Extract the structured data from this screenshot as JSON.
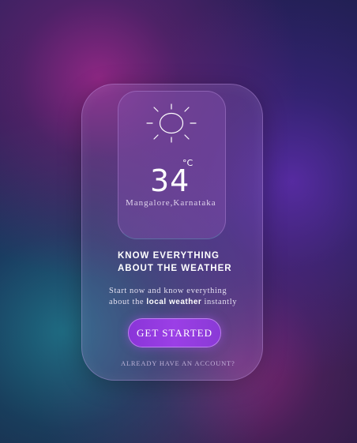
{
  "weather": {
    "temperature": "34",
    "unit": "°C",
    "location": "Mangalore,Karnataka",
    "icon": "sun-icon"
  },
  "headline": {
    "line1": "KNOW EVERYTHING",
    "line2": "ABOUT THE WEATHER"
  },
  "description": {
    "line1": "Start now and know everything",
    "line2_pre": "about the ",
    "line2_bold": "local weather",
    "line2_post": " instantly"
  },
  "cta": {
    "label": "GET STARTED"
  },
  "login": {
    "label": "ALREADY HAVE AN ACCOUNT?"
  },
  "colors": {
    "accent": "#9b3fe6",
    "text": "#ffffff"
  }
}
